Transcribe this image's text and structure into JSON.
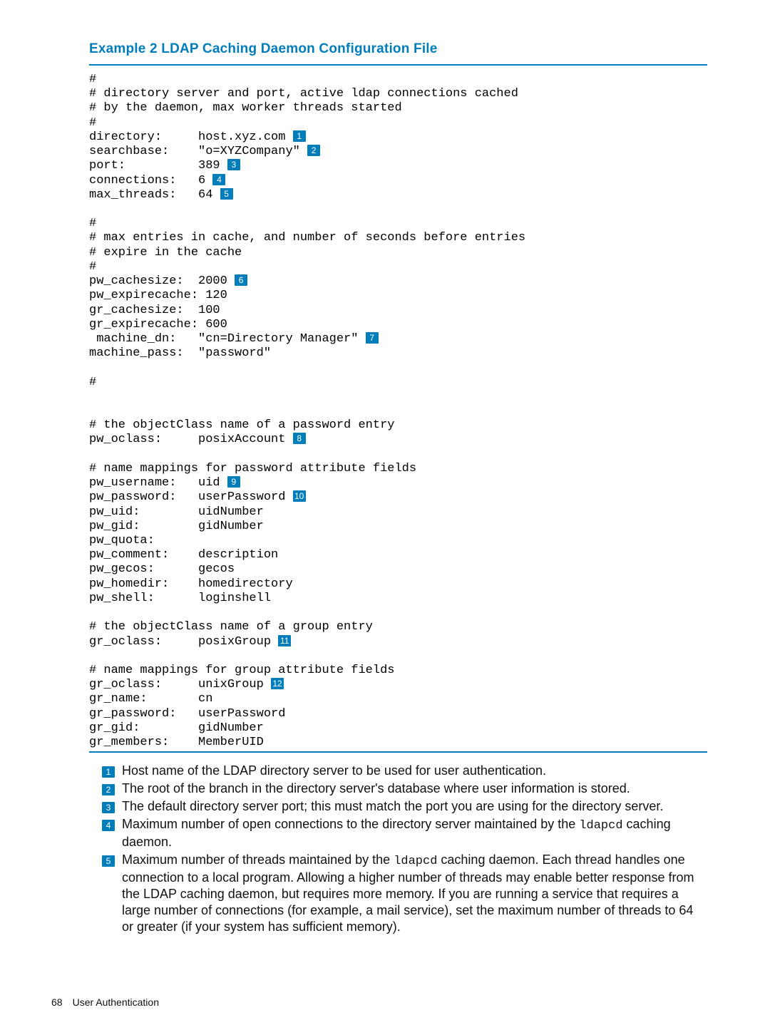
{
  "heading": "Example 2 LDAP Caching Daemon Configuration File",
  "code": {
    "c01": "#",
    "c02": "# directory server and port, active ldap connections cached",
    "c03": "# by the daemon, max worker threads started",
    "c04": "#",
    "c05a": "directory:     host.xyz.com ",
    "c06a": "searchbase:    \"o=XYZCompany\" ",
    "c07a": "port:          389 ",
    "c08a": "connections:   6 ",
    "c09a": "max_threads:   64 ",
    "blank1": "",
    "c10": "#",
    "c11": "# max entries in cache, and number of seconds before entries",
    "c12": "# expire in the cache",
    "c13": "#",
    "c14a": "pw_cachesize:  2000 ",
    "c15": "pw_expirecache: 120",
    "c16": "gr_cachesize:  100",
    "c17": "gr_expirecache: 600",
    "c18a": " machine_dn:   \"cn=Directory Manager\" ",
    "c19": "machine_pass:  \"password\"",
    "blank2": "",
    "c20": "#",
    "blank3": "",
    "blank4": "",
    "c21": "# the objectClass name of a password entry",
    "c22a": "pw_oclass:     posixAccount ",
    "blank5": "",
    "c23": "# name mappings for password attribute fields",
    "c24a": "pw_username:   uid ",
    "c25a": "pw_password:   userPassword ",
    "c26": "pw_uid:        uidNumber",
    "c27": "pw_gid:        gidNumber",
    "c28": "pw_quota:",
    "c29": "pw_comment:    description",
    "c30": "pw_gecos:      gecos",
    "c31": "pw_homedir:    homedirectory",
    "c32": "pw_shell:      loginshell",
    "blank6": "",
    "c33": "# the objectClass name of a group entry",
    "c34a": "gr_oclass:     posixGroup ",
    "blank7": "",
    "c35": "# name mappings for group attribute fields",
    "c36a": "gr_oclass:     unixGroup ",
    "c37": "gr_name:       cn",
    "c38": "gr_password:   userPassword",
    "c39": "gr_gid:        gidNumber",
    "c40": "gr_members:    MemberUID"
  },
  "refs": {
    "r1": "1",
    "r2": "2",
    "r3": "3",
    "r4": "4",
    "r5": "5",
    "r6": "6",
    "r7": "7",
    "r8": "8",
    "r9": "9",
    "r10": "10",
    "r11": "11",
    "r12": "12"
  },
  "notes": {
    "n1": "Host name of the LDAP directory server to be used for user authentication.",
    "n2": "The root of the branch in the directory server's database where user information is stored.",
    "n3": "The default directory server port; this must match the port you are using for the directory server.",
    "n4a": "Maximum number of open connections to the directory server maintained by the ",
    "n4_code": "ldapcd",
    "n4b": " caching daemon.",
    "n5a": "Maximum number of threads maintained by the ",
    "n5_code": "ldapcd",
    "n5b": " caching daemon. Each thread handles one connection to a local program. Allowing a higher number of threads may enable better response from the LDAP caching daemon, but requires more memory. If you are running a service that requires a large number of connections (for example, a mail service), set the maximum number of threads to 64 or greater (if your system has sufficient memory)."
  },
  "footer": {
    "page": "68",
    "section": "User Authentication"
  }
}
